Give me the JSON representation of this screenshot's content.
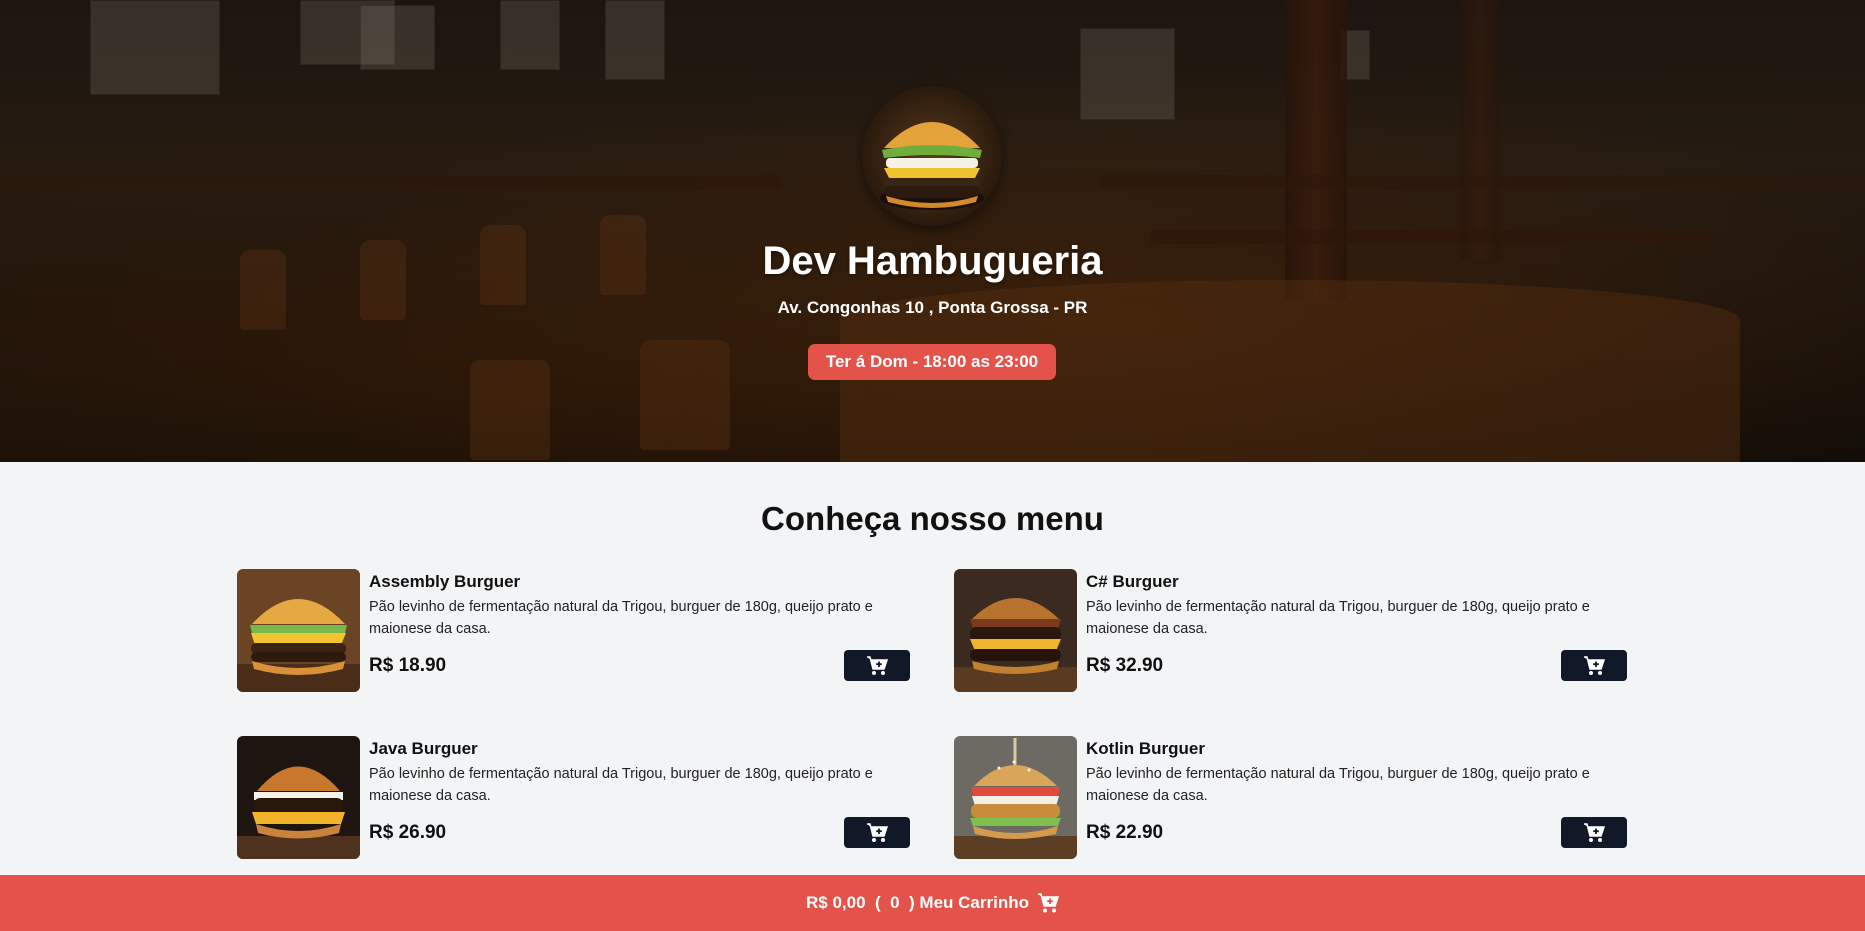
{
  "header": {
    "title": "Dev Hambugueria",
    "address": "Av. Congonhas 10 , Ponta Grossa - PR",
    "hours": "Ter á Dom - 18:00 as 23:00",
    "logo_icon": "burger-logo"
  },
  "menu": {
    "heading": "Conheça nosso menu",
    "items": [
      {
        "name": "Assembly Burguer",
        "description": "Pão levinho de fermentação natural da Trigou, burguer de 180g, queijo prato e maionese da casa.",
        "price": "R$ 18.90",
        "icon": "cart-plus-icon"
      },
      {
        "name": "C# Burguer",
        "description": "Pão levinho de fermentação natural da Trigou, burguer de 180g, queijo prato e maionese da casa.",
        "price": "R$ 32.90",
        "icon": "cart-plus-icon"
      },
      {
        "name": "Java Burguer",
        "description": "Pão levinho de fermentação natural da Trigou, burguer de 180g, queijo prato e maionese da casa.",
        "price": "R$ 26.90",
        "icon": "cart-plus-icon"
      },
      {
        "name": "Kotlin Burguer",
        "description": "Pão levinho de fermentação natural da Trigou, burguer de 180g, queijo prato e maionese da casa.",
        "price": "R$ 22.90",
        "icon": "cart-plus-icon"
      }
    ]
  },
  "footer": {
    "total": "R$ 0,00",
    "count": "0",
    "label": "Meu Carrinho",
    "icon": "cart-icon"
  },
  "colors": {
    "accent": "#e4534a",
    "button_dark": "#111827",
    "background": "#f3f4f6"
  }
}
